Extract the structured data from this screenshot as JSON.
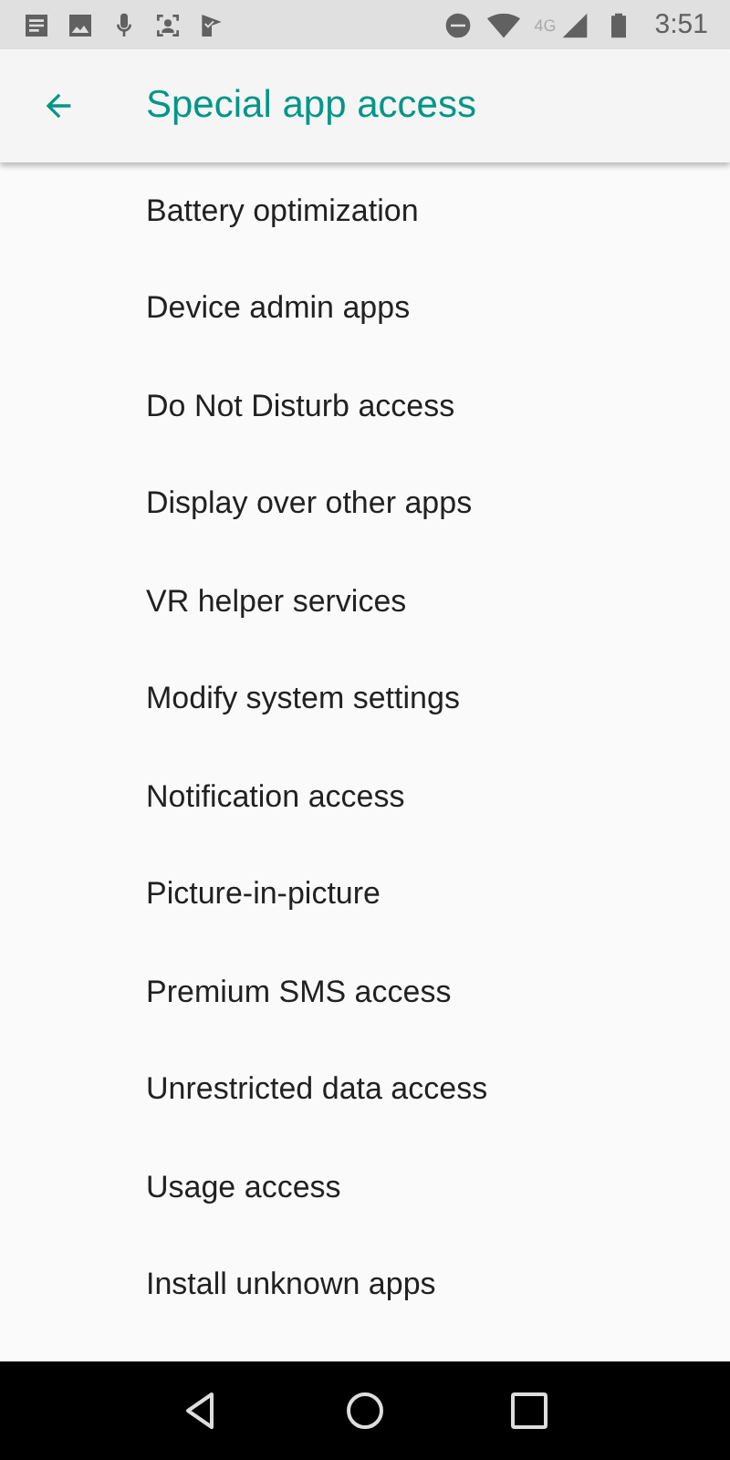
{
  "status_bar": {
    "network": "4G",
    "time": "3:51"
  },
  "app_bar": {
    "title": "Special app access"
  },
  "items": [
    {
      "label": "Battery optimization"
    },
    {
      "label": "Device admin apps"
    },
    {
      "label": "Do Not Disturb access"
    },
    {
      "label": "Display over other apps"
    },
    {
      "label": "VR helper services"
    },
    {
      "label": "Modify system settings"
    },
    {
      "label": "Notification access"
    },
    {
      "label": "Picture-in-picture"
    },
    {
      "label": "Premium SMS access"
    },
    {
      "label": "Unrestricted data access"
    },
    {
      "label": "Usage access"
    },
    {
      "label": "Install unknown apps"
    }
  ]
}
